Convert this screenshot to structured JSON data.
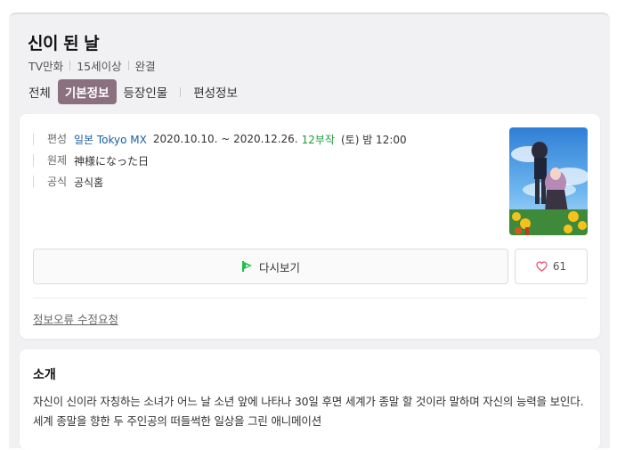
{
  "title": "신이 된 날",
  "meta": [
    "TV만화",
    "15세이상",
    "완결"
  ],
  "tabs": [
    {
      "label": "전체",
      "active": false
    },
    {
      "label": "기본정보",
      "active": true
    },
    {
      "label": "등장인물",
      "active": false
    },
    {
      "label": "편성정보",
      "active": false
    }
  ],
  "info": {
    "broadcast": {
      "label": "편성",
      "channel": "일본 Tokyo MX",
      "period": "2020.10.10. ~ 2020.12.26.",
      "episodes": "12부작",
      "schedule": "(토) 밤 12:00"
    },
    "original": {
      "label": "원제",
      "value": "神様になった日"
    },
    "official": {
      "label": "공식",
      "value": "공식홈"
    }
  },
  "actions": {
    "rewatch_label": "다시보기",
    "like_count": "61"
  },
  "report_label": "정보오류 수정요청",
  "intro": {
    "title": "소개",
    "text": "자신이 신이라 자칭하는 소녀가 어느 날 소년 앞에 나타나 30일 후면 세계가 종말 할 것이라 말하며 자신의 능력을 보인다. 세계 종말을 향한 두 주인공의 떠들썩한 일상을 그린 애니메이션"
  },
  "colors": {
    "accent_tab": "#8b7080",
    "link": "#1a5fa0",
    "episodes_green": "#1f9b3c",
    "like_heart": "#e5546a",
    "rewatch_icon": "#1fbf4a"
  }
}
